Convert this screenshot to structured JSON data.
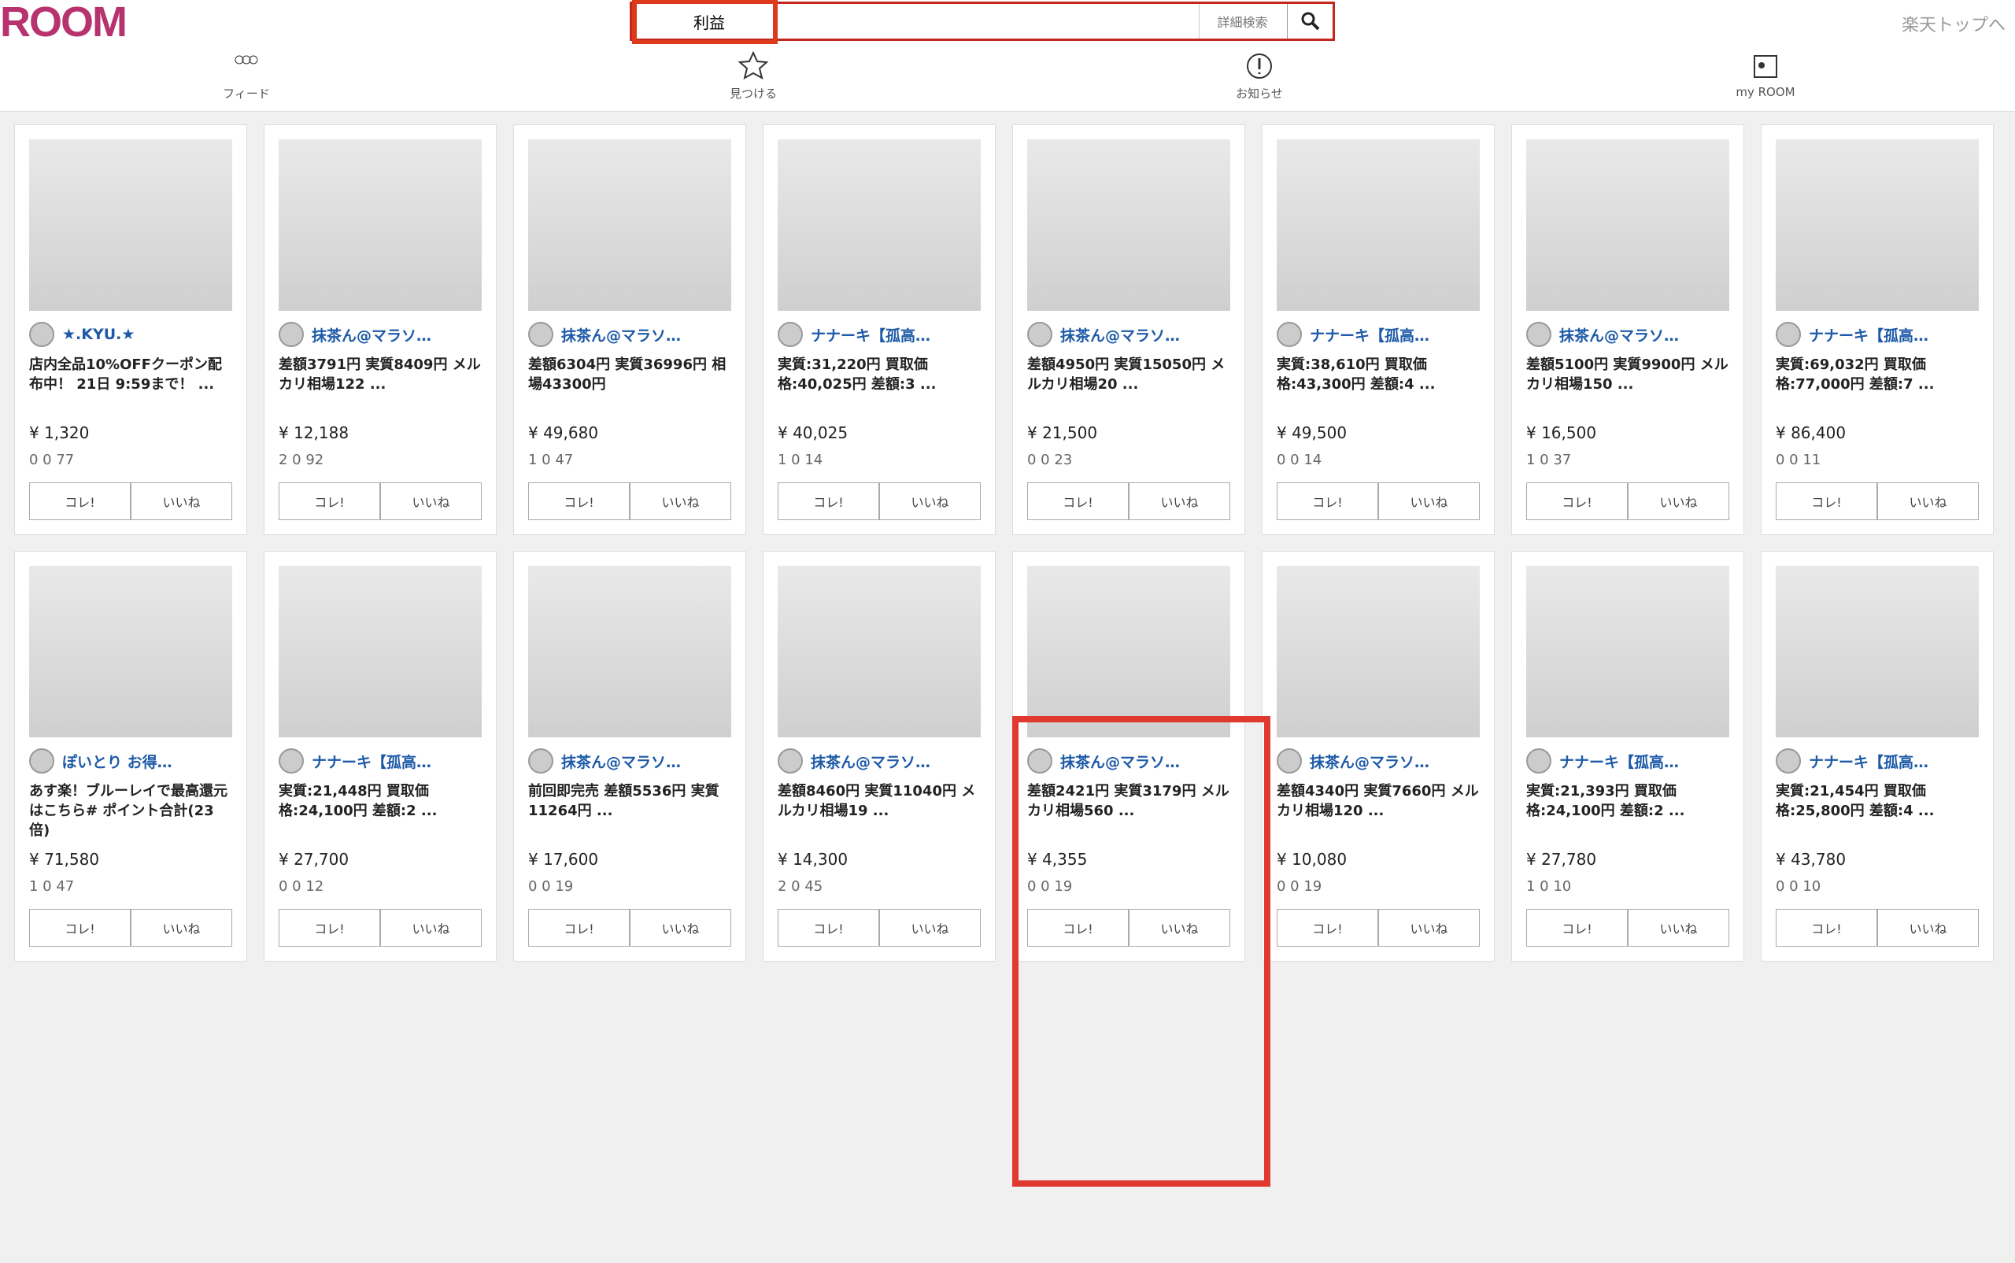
{
  "header": {
    "logo": "ROOM",
    "search_value": "利益",
    "advanced": "詳細検索",
    "top_link": "楽天トップへ"
  },
  "nav": [
    {
      "label": "フィード"
    },
    {
      "label": "見つける"
    },
    {
      "label": "お知らせ"
    },
    {
      "label": "my ROOM"
    }
  ],
  "cards": [
    {
      "user": "★.KYU.★",
      "desc": "店内全品10%OFFクーポン配布中！ 21日 9:59まで！ ...",
      "price": "¥ 1,320",
      "stats": "0 0 77"
    },
    {
      "user": "抹茶ん@マラソ…",
      "desc": "差額3791円 実質8409円 メルカリ相場122 ...",
      "price": "¥ 12,188",
      "stats": "2 0 92"
    },
    {
      "user": "抹茶ん@マラソ…",
      "desc": "差額6304円 実質36996円 相場43300円",
      "price": "¥ 49,680",
      "stats": "1 0 47"
    },
    {
      "user": "ナナーキ【孤高…",
      "desc": "実質:31,220円 買取価格:40,025円 差額:3 ...",
      "price": "¥ 40,025",
      "stats": "1 0 14"
    },
    {
      "user": "抹茶ん@マラソ…",
      "desc": "差額4950円 実質15050円 メルカリ相場20 ...",
      "price": "¥ 21,500",
      "stats": "0 0 23"
    },
    {
      "user": "ナナーキ【孤高…",
      "desc": "実質:38,610円 買取価格:43,300円 差額:4 ...",
      "price": "¥ 49,500",
      "stats": "0 0 14"
    },
    {
      "user": "抹茶ん@マラソ…",
      "desc": "差額5100円 実質9900円 メルカリ相場150 ...",
      "price": "¥ 16,500",
      "stats": "1 0 37"
    },
    {
      "user": "ナナーキ【孤高…",
      "desc": "実質:69,032円 買取価格:77,000円 差額:7 ...",
      "price": "¥ 86,400",
      "stats": "0 0 11"
    },
    {
      "user": "ぽいとり お得…",
      "desc": "あす楽！ブルーレイで最高還元はこちら# ポイント合計(23倍)",
      "price": "¥ 71,580",
      "stats": "1 0 47"
    },
    {
      "user": "ナナーキ【孤高…",
      "desc": "実質:21,448円 買取価格:24,100円 差額:2 ...",
      "price": "¥ 27,700",
      "stats": "0 0 12"
    },
    {
      "user": "抹茶ん@マラソ…",
      "desc": "前回即完売 差額5536円 実質11264円 ...",
      "price": "¥ 17,600",
      "stats": "0 0 19"
    },
    {
      "user": "抹茶ん@マラソ…",
      "desc": "差額8460円 実質11040円 メルカリ相場19 ...",
      "price": "¥ 14,300",
      "stats": "2 0 45"
    },
    {
      "user": "抹茶ん@マラソ…",
      "desc": "差額2421円 実質3179円 メルカリ相場560 ...",
      "price": "¥ 4,355",
      "stats": "0 0 19"
    },
    {
      "user": "抹茶ん@マラソ…",
      "desc": "差額4340円 実質7660円 メルカリ相場120 ...",
      "price": "¥ 10,080",
      "stats": "0 0 19"
    },
    {
      "user": "ナナーキ【孤高…",
      "desc": "実質:21,393円 買取価格:24,100円 差額:2 ...",
      "price": "¥ 27,780",
      "stats": "1 0 10"
    },
    {
      "user": "ナナーキ【孤高…",
      "desc": "実質:21,454円 買取価格:25,800円 差額:4 ...",
      "price": "¥ 43,780",
      "stats": "0 0 10"
    }
  ],
  "buttons": {
    "kore": "コレ!",
    "iine": "いいね"
  }
}
